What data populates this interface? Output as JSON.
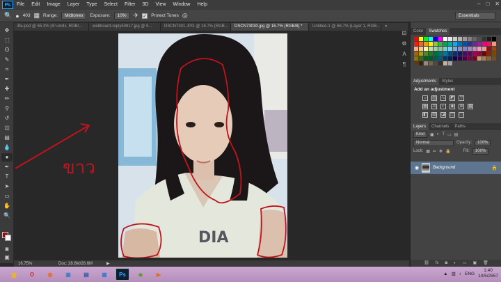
{
  "app": {
    "logo": "Ps"
  },
  "menu": [
    "File",
    "Edit",
    "Image",
    "Layer",
    "Type",
    "Select",
    "Filter",
    "3D",
    "View",
    "Window",
    "Help"
  ],
  "options": {
    "brush_size": "403",
    "range_label": "Range:",
    "range_value": "Midtones",
    "exposure_label": "Exposure:",
    "exposure_value": "10%",
    "protect_tones": "Protect Tones",
    "workspace": "Essentials"
  },
  "tabs": [
    {
      "label": "ดีม.psd @ 65.3% (ข้างหลัง, RGB/...",
      "active": false
    },
    {
      "label": "webboard-reply50917.jpg @ 5...",
      "active": false
    },
    {
      "label": "DSCN7301.JPG @ 16.7% (RGB...",
      "active": false
    },
    {
      "label": "DSCN73030.jpg @ 16.7% (RGB/8) *",
      "active": true
    },
    {
      "label": "Untitled-1 @ 66.7% (Layer 1, RGB...",
      "active": false
    }
  ],
  "status": {
    "zoom": "16.75%",
    "doc": "Doc: 28.6M/28.6M"
  },
  "annotation_text": "ขาว",
  "panels": {
    "color_tab": "Color",
    "swatches_tab": "Swatches",
    "adjustments_tab": "Adjustments",
    "styles_tab": "Styles",
    "add_adjustment": "Add an adjustment",
    "layers_tab": "Layers",
    "channels_tab": "Channels",
    "paths_tab": "Paths",
    "kind_label": "Kind",
    "blend_mode": "Normal",
    "opacity_label": "Opacity:",
    "opacity_value": "100%",
    "lock_label": "Lock:",
    "fill_label": "Fill:",
    "fill_value": "100%",
    "layer_name": "Background"
  },
  "taskbar": {
    "lang": "ENG",
    "time": "1:40",
    "date": "10/5/2557",
    "apps": [
      "file-explorer",
      "opera",
      "firefox",
      "image-viewer",
      "document",
      "photoshop",
      "game",
      "media"
    ]
  },
  "colors": {
    "foreground": "#8b1010",
    "background": "#ffffff",
    "annotation_red": "#c0141c",
    "layer_selected": "#5e7590"
  }
}
